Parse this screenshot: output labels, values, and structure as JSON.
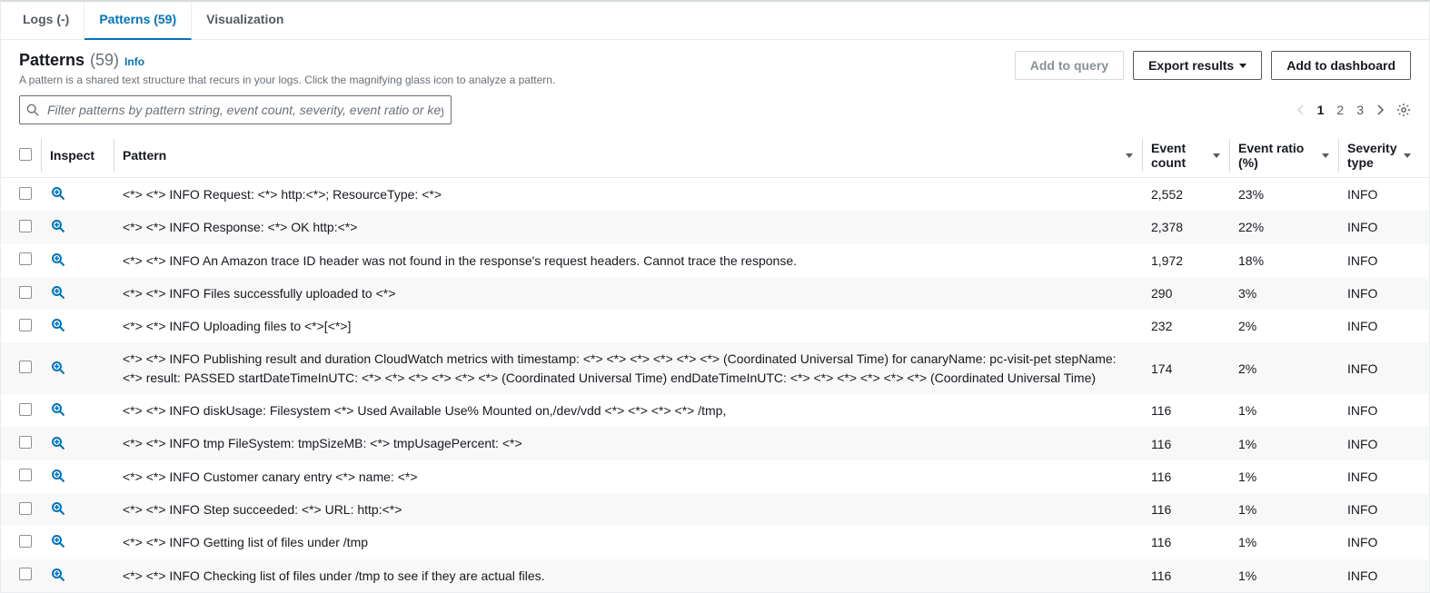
{
  "tabs": {
    "logs": "Logs (-)",
    "patterns": "Patterns (59)",
    "visualization": "Visualization"
  },
  "header": {
    "title": "Patterns",
    "count": "(59)",
    "info": "Info",
    "subtitle": "A pattern is a shared text structure that recurs in your logs. Click the magnifying glass icon to analyze a pattern.",
    "add_to_query": "Add to query",
    "export_results": "Export results",
    "add_to_dashboard": "Add to dashboard"
  },
  "filter": {
    "placeholder": "Filter patterns by pattern string, event count, severity, event ratio or keywords"
  },
  "pagination": {
    "p1": "1",
    "p2": "2",
    "p3": "3"
  },
  "columns": {
    "inspect": "Inspect",
    "pattern": "Pattern",
    "event_count": "Event count",
    "event_ratio": "Event ratio (%)",
    "severity": "Severity type"
  },
  "rows": [
    {
      "pattern": "<*> <*> INFO Request: <*> http:<*>; ResourceType: <*>",
      "count": "2,552",
      "ratio": "23%",
      "severity": "INFO"
    },
    {
      "pattern": "<*> <*> INFO Response: <*> OK http:<*>",
      "count": "2,378",
      "ratio": "22%",
      "severity": "INFO"
    },
    {
      "pattern": "<*> <*> INFO An Amazon trace ID header was not found in the response's request headers. Cannot trace the response.",
      "count": "1,972",
      "ratio": "18%",
      "severity": "INFO"
    },
    {
      "pattern": "<*> <*> INFO Files successfully uploaded to <*>",
      "count": "290",
      "ratio": "3%",
      "severity": "INFO"
    },
    {
      "pattern": "<*> <*> INFO Uploading files to <*>[<*>]",
      "count": "232",
      "ratio": "2%",
      "severity": "INFO"
    },
    {
      "pattern": "<*> <*> INFO Publishing result and duration CloudWatch metrics with timestamp: <*> <*> <*> <*> <*> <*> (Coordinated Universal Time) for canaryName: pc-visit-pet stepName: <*> result: PASSED startDateTimeInUTC: <*> <*> <*> <*> <*> <*> (Coordinated Universal Time) endDateTimeInUTC: <*> <*> <*> <*> <*> <*> (Coordinated Universal Time)",
      "count": "174",
      "ratio": "2%",
      "severity": "INFO"
    },
    {
      "pattern": "<*> <*> INFO diskUsage: Filesystem <*> Used Available Use% Mounted on,/dev/vdd <*> <*> <*> <*> /tmp,",
      "count": "116",
      "ratio": "1%",
      "severity": "INFO"
    },
    {
      "pattern": "<*> <*> INFO tmp FileSystem: tmpSizeMB: <*> tmpUsagePercent: <*>",
      "count": "116",
      "ratio": "1%",
      "severity": "INFO"
    },
    {
      "pattern": "<*> <*> INFO Customer canary entry <*> name: <*>",
      "count": "116",
      "ratio": "1%",
      "severity": "INFO"
    },
    {
      "pattern": "<*> <*> INFO Step succeeded: <*> URL: http:<*>",
      "count": "116",
      "ratio": "1%",
      "severity": "INFO"
    },
    {
      "pattern": "<*> <*> INFO Getting list of files under /tmp",
      "count": "116",
      "ratio": "1%",
      "severity": "INFO"
    },
    {
      "pattern": "<*> <*> INFO Checking list of files under /tmp to see if they are actual files.",
      "count": "116",
      "ratio": "1%",
      "severity": "INFO"
    }
  ]
}
